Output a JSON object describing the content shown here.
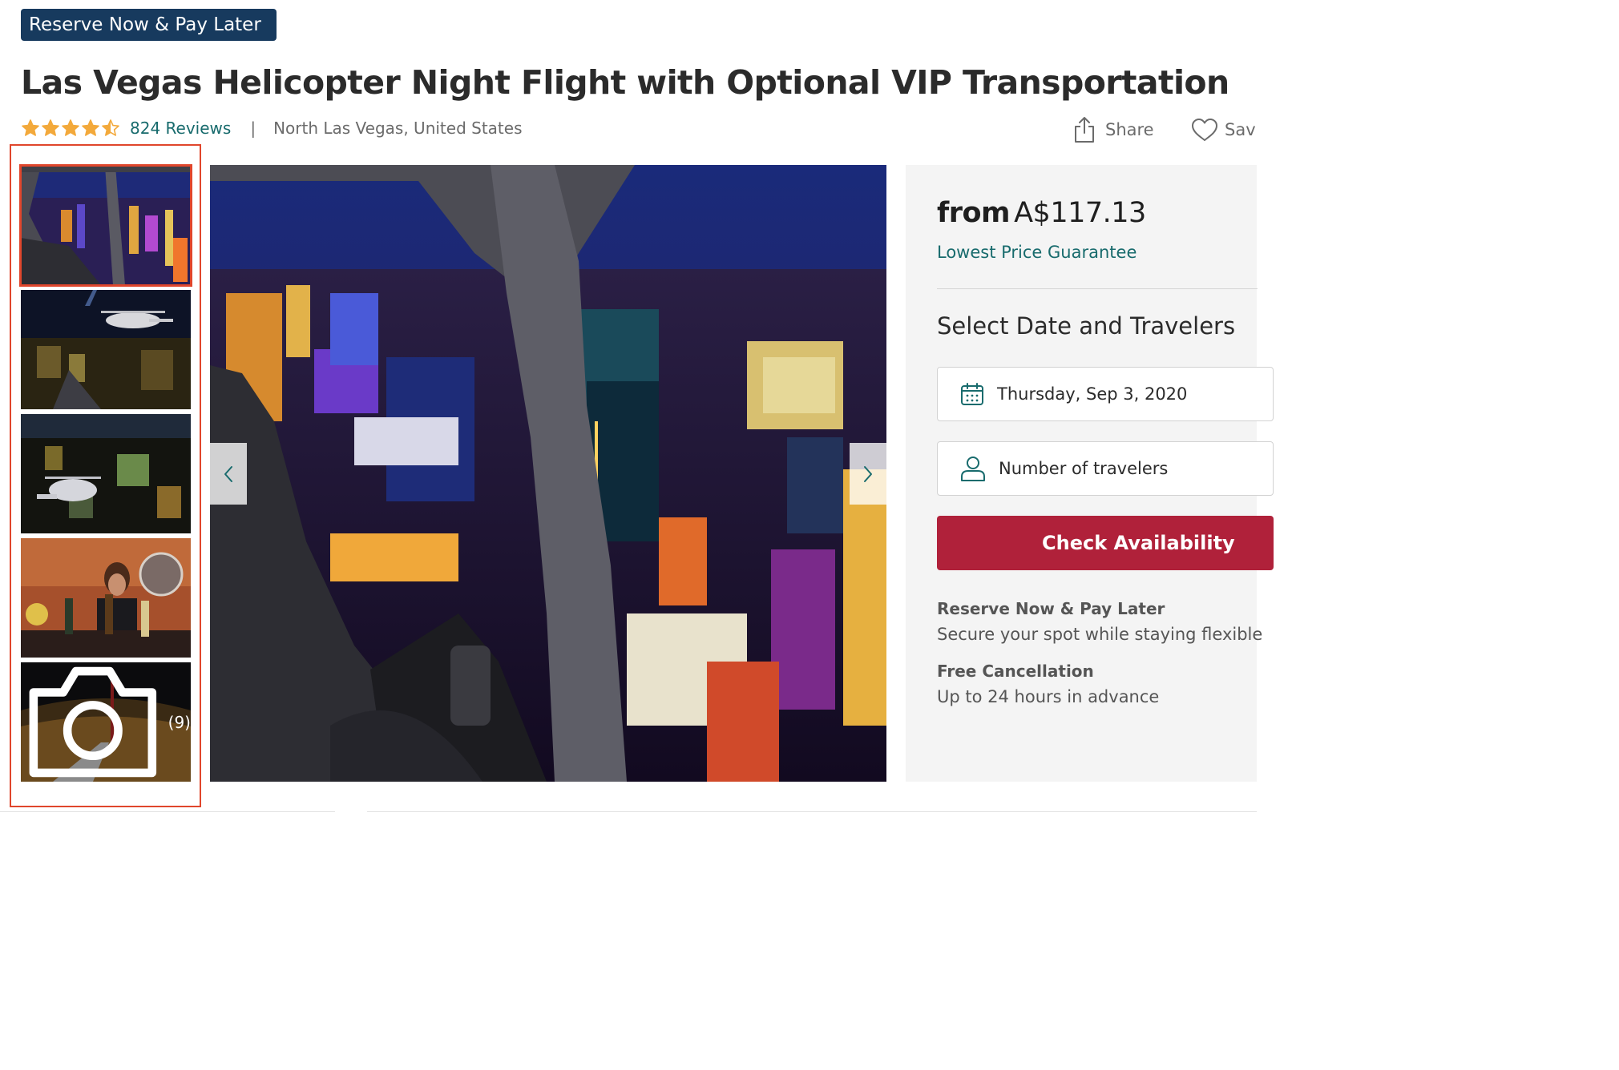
{
  "badge": {
    "label": "Reserve Now & Pay Later"
  },
  "product": {
    "title": "Las Vegas Helicopter Night Flight with Optional VIP Transportation",
    "rating": 4.5,
    "rating_max": 5,
    "reviews_label": "824 Reviews",
    "separator": "|",
    "location": "North Las Vegas, United States"
  },
  "actions": {
    "share_label": "Share",
    "save_label": "Sav"
  },
  "gallery": {
    "thumbnails": [
      {
        "name": "thumbnail-cockpit-night-view",
        "selected": true
      },
      {
        "name": "thumbnail-helicopter-over-strip",
        "selected": false
      },
      {
        "name": "thumbnail-helicopter-above-city",
        "selected": false
      },
      {
        "name": "thumbnail-host-with-wine",
        "selected": false
      },
      {
        "name": "thumbnail-more-photos",
        "selected": false
      }
    ],
    "more_count": "(9)",
    "icons": {
      "camera": "camera-icon",
      "prev": "chevron-left-icon",
      "next": "chevron-right-icon"
    }
  },
  "booking": {
    "price_prefix": "from",
    "price": "A$117.13",
    "guarantee": "Lowest Price Guarantee",
    "heading": "Select Date and Travelers",
    "date_value": "Thursday, Sep 3, 2020",
    "travelers_placeholder": "Number of travelers",
    "cta": "Check Availability",
    "reserve_title": "Reserve Now & Pay Later",
    "reserve_text": "Secure your spot while staying flexible",
    "cancel_title": "Free Cancellation",
    "cancel_text": "Up to 24 hours in advance"
  },
  "colors": {
    "badge_bg": "#173a5e",
    "link_teal": "#186b6d",
    "star": "#f3a93b",
    "cta_red": "#b0213a",
    "selection_outline": "#e0462c"
  }
}
